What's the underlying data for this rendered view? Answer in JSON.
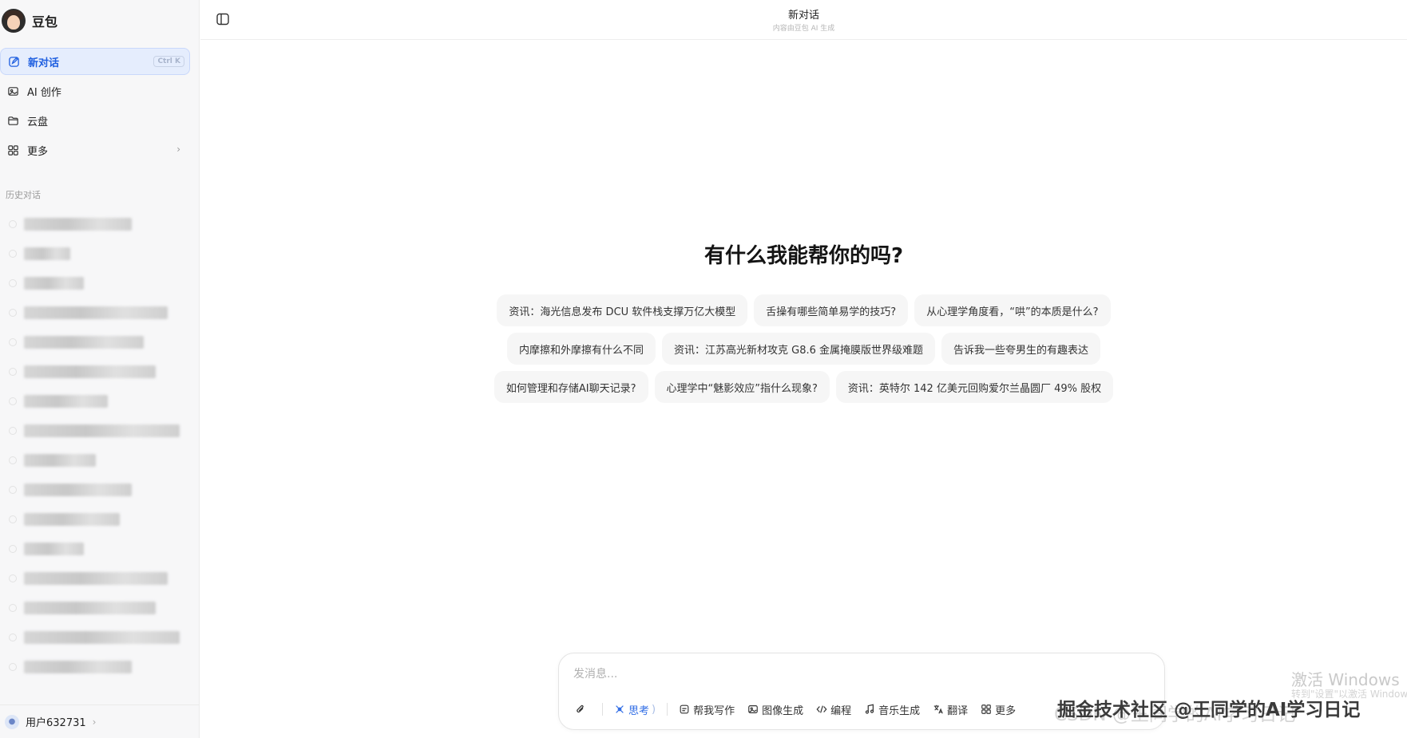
{
  "app": {
    "brand_name": "豆包"
  },
  "sidebar": {
    "nav": [
      {
        "label": "新对话",
        "shortcut": "Ctrl K",
        "icon": "new-chat-icon",
        "active": true
      },
      {
        "label": "AI 创作",
        "icon": "image-icon"
      },
      {
        "label": "云盘",
        "icon": "folder-icon"
      },
      {
        "label": "更多",
        "icon": "grid-icon"
      }
    ],
    "history_title": "历史对话",
    "user_label": "用户632731"
  },
  "header": {
    "title": "新对话",
    "subtitle": "内容由豆包 AI 生成"
  },
  "main": {
    "hero": "有什么我能帮你的吗?",
    "suggestions": [
      [
        "资讯：海光信息发布 DCU 软件栈支撑万亿大模型",
        "舌操有哪些简单易学的技巧?",
        "从心理学角度看，“哄”的本质是什么?"
      ],
      [
        "内摩擦和外摩擦有什么不同",
        "资讯：江苏高光新材攻克 G8.6 金属掩膜版世界级难题",
        "告诉我一些夸男生的有趣表达"
      ],
      [
        "如何管理和存储AI聊天记录?",
        "心理学中“魅影效应”指什么现象?",
        "资讯：英特尔 142 亿美元回购爱尔兰晶圆厂 49% 股权"
      ]
    ]
  },
  "composer": {
    "placeholder": "发消息...",
    "tools": {
      "think": "思考",
      "write": "帮我写作",
      "image": "图像生成",
      "code": "编程",
      "music": "音乐生成",
      "translate": "翻译",
      "more": "更多"
    }
  },
  "overlay": {
    "windows_activate": "激活 Windows",
    "windows_hint": "转到\"设置\"以激活 Windows。",
    "watermark_csdn": "CSDN @王同学的AI学习日记",
    "watermark_juejin": "掘金技术社区 @王同学的AI学习日记"
  },
  "colors": {
    "accent": "#1f5fe0",
    "active_bg": "#e5edfd",
    "chip_bg": "#f6f6f6"
  }
}
